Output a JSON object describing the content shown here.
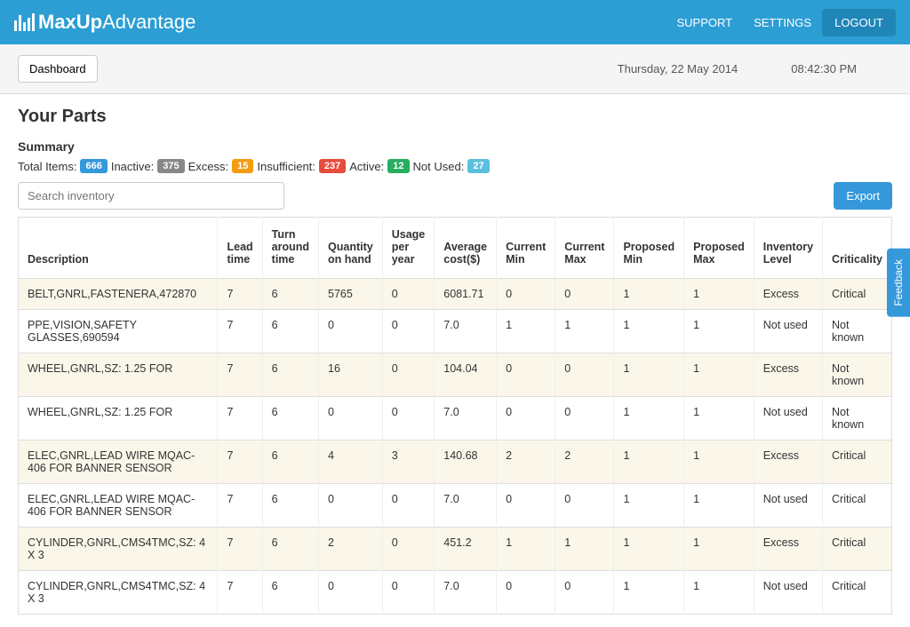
{
  "brand": {
    "name_strong": "MaxUp",
    "name_light": "Advantage"
  },
  "nav": {
    "support": "SUPPORT",
    "settings": "SETTINGS",
    "logout": "LOGOUT"
  },
  "subbar": {
    "dashboard": "Dashboard",
    "date": "Thursday, 22 May 2014",
    "time": "08:42:30 PM"
  },
  "page": {
    "title": "Your Parts",
    "summary_label": "Summary"
  },
  "summary": {
    "total_label": "Total Items:",
    "total_value": "666",
    "inactive_label": "Inactive:",
    "inactive_value": "375",
    "excess_label": "Excess:",
    "excess_value": "15",
    "insufficient_label": "Insufficient:",
    "insufficient_value": "237",
    "active_label": "Active:",
    "active_value": "12",
    "notused_label": "Not Used:",
    "notused_value": "27"
  },
  "toolbar": {
    "search_placeholder": "Search inventory",
    "export": "Export"
  },
  "columns": {
    "desc": "Description",
    "lead": "Lead time",
    "turn": "Turn around time",
    "qty": "Quantity on hand",
    "usage": "Usage per year",
    "avg": "Average cost($)",
    "cmin": "Current Min",
    "cmax": "Current Max",
    "pmin": "Proposed Min",
    "pmax": "Proposed Max",
    "inv": "Inventory Level",
    "crit": "Criticality"
  },
  "rows": [
    {
      "desc": "BELT,GNRL,FASTENERA,472870",
      "lead": "7",
      "turn": "6",
      "qty": "5765",
      "usage": "0",
      "avg": "6081.71",
      "cmin": "0",
      "cmax": "0",
      "pmin": "1",
      "pmax": "1",
      "inv": "Excess",
      "crit": "Critical"
    },
    {
      "desc": "PPE,VISION,SAFETY GLASSES,690594",
      "lead": "7",
      "turn": "6",
      "qty": "0",
      "usage": "0",
      "avg": "7.0",
      "cmin": "1",
      "cmax": "1",
      "pmin": "1",
      "pmax": "1",
      "inv": "Not used",
      "crit": "Not known"
    },
    {
      "desc": "WHEEL,GNRL,SZ: 1.25 FOR",
      "lead": "7",
      "turn": "6",
      "qty": "16",
      "usage": "0",
      "avg": "104.04",
      "cmin": "0",
      "cmax": "0",
      "pmin": "1",
      "pmax": "1",
      "inv": "Excess",
      "crit": "Not known"
    },
    {
      "desc": "WHEEL,GNRL,SZ: 1.25 FOR",
      "lead": "7",
      "turn": "6",
      "qty": "0",
      "usage": "0",
      "avg": "7.0",
      "cmin": "0",
      "cmax": "0",
      "pmin": "1",
      "pmax": "1",
      "inv": "Not used",
      "crit": "Not known"
    },
    {
      "desc": "ELEC,GNRL,LEAD WIRE MQAC-406 FOR BANNER SENSOR",
      "lead": "7",
      "turn": "6",
      "qty": "4",
      "usage": "3",
      "avg": "140.68",
      "cmin": "2",
      "cmax": "2",
      "pmin": "1",
      "pmax": "1",
      "inv": "Excess",
      "crit": "Critical"
    },
    {
      "desc": "ELEC,GNRL,LEAD WIRE MQAC-406 FOR BANNER SENSOR",
      "lead": "7",
      "turn": "6",
      "qty": "0",
      "usage": "0",
      "avg": "7.0",
      "cmin": "0",
      "cmax": "0",
      "pmin": "1",
      "pmax": "1",
      "inv": "Not used",
      "crit": "Critical"
    },
    {
      "desc": "CYLINDER,GNRL,CMS4TMC,SZ: 4 X 3",
      "lead": "7",
      "turn": "6",
      "qty": "2",
      "usage": "0",
      "avg": "451.2",
      "cmin": "1",
      "cmax": "1",
      "pmin": "1",
      "pmax": "1",
      "inv": "Excess",
      "crit": "Critical"
    },
    {
      "desc": "CYLINDER,GNRL,CMS4TMC,SZ: 4 X 3",
      "lead": "7",
      "turn": "6",
      "qty": "0",
      "usage": "0",
      "avg": "7.0",
      "cmin": "0",
      "cmax": "0",
      "pmin": "1",
      "pmax": "1",
      "inv": "Not used",
      "crit": "Critical"
    }
  ],
  "feedback": "Feedback"
}
